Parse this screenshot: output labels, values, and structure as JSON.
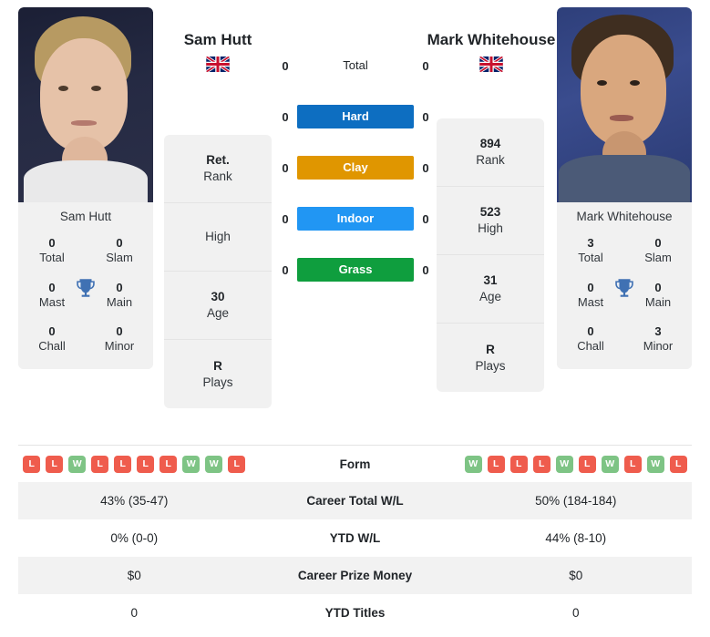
{
  "players": {
    "left": {
      "name": "Sam Hutt",
      "flag": "uk-flag-icon",
      "photo_label": "Sam Hutt",
      "titles": [
        {
          "num": "0",
          "label": "Total"
        },
        {
          "num": "0",
          "label": "Slam"
        },
        {
          "num": "0",
          "label": "Mast"
        },
        {
          "num": "0",
          "label": "Main"
        },
        {
          "num": "0",
          "label": "Chall"
        },
        {
          "num": "0",
          "label": "Minor"
        }
      ],
      "info": [
        {
          "value": "Ret.",
          "key": "Rank"
        },
        {
          "value": "",
          "key": "High"
        },
        {
          "value": "30",
          "key": "Age"
        },
        {
          "value": "R",
          "key": "Plays"
        }
      ],
      "form": [
        "L",
        "L",
        "W",
        "L",
        "L",
        "L",
        "L",
        "W",
        "W",
        "L"
      ],
      "career_total_wl": "43% (35-47)",
      "ytd_wl": "0% (0-0)",
      "career_prize_money": "$0",
      "ytd_titles": "0"
    },
    "right": {
      "name": "Mark Whitehouse",
      "flag": "uk-flag-icon",
      "photo_label": "Mark Whitehouse",
      "titles": [
        {
          "num": "3",
          "label": "Total"
        },
        {
          "num": "0",
          "label": "Slam"
        },
        {
          "num": "0",
          "label": "Mast"
        },
        {
          "num": "0",
          "label": "Main"
        },
        {
          "num": "0",
          "label": "Chall"
        },
        {
          "num": "3",
          "label": "Minor"
        }
      ],
      "info": [
        {
          "value": "894",
          "key": "Rank"
        },
        {
          "value": "523",
          "key": "High"
        },
        {
          "value": "31",
          "key": "Age"
        },
        {
          "value": "R",
          "key": "Plays"
        }
      ],
      "form": [
        "W",
        "L",
        "L",
        "L",
        "W",
        "L",
        "W",
        "L",
        "W",
        "L"
      ],
      "career_total_wl": "50% (184-184)",
      "ytd_wl": "44% (8-10)",
      "career_prize_money": "$0",
      "ytd_titles": "0"
    }
  },
  "head_to_head": [
    {
      "label": "Total",
      "left": "0",
      "right": "0",
      "badge": false,
      "color": ""
    },
    {
      "label": "Hard",
      "left": "0",
      "right": "0",
      "badge": true,
      "color": "#0d6ec1"
    },
    {
      "label": "Clay",
      "left": "0",
      "right": "0",
      "badge": true,
      "color": "#e09600"
    },
    {
      "label": "Indoor",
      "left": "0",
      "right": "0",
      "badge": true,
      "color": "#2196f3"
    },
    {
      "label": "Grass",
      "left": "0",
      "right": "0",
      "badge": true,
      "color": "#0f9e3e"
    }
  ],
  "stats_rows": [
    {
      "label": "Form",
      "type": "form"
    },
    {
      "label": "Career Total W/L",
      "type": "text",
      "left": "43% (35-47)",
      "right": "50% (184-184)"
    },
    {
      "label": "YTD W/L",
      "type": "text",
      "left": "0% (0-0)",
      "right": "44% (8-10)"
    },
    {
      "label": "Career Prize Money",
      "type": "text",
      "left": "$0",
      "right": "$0"
    },
    {
      "label": "YTD Titles",
      "type": "text",
      "left": "0",
      "right": "0"
    }
  ],
  "colors": {
    "hard": "#0d6ec1",
    "clay": "#e09600",
    "indoor": "#2196f3",
    "grass": "#0f9e3e",
    "win_badge": "#7ec485",
    "loss_badge": "#ef5c4d",
    "panel": "#f1f1f1",
    "stripe": "#f2f2f2"
  }
}
